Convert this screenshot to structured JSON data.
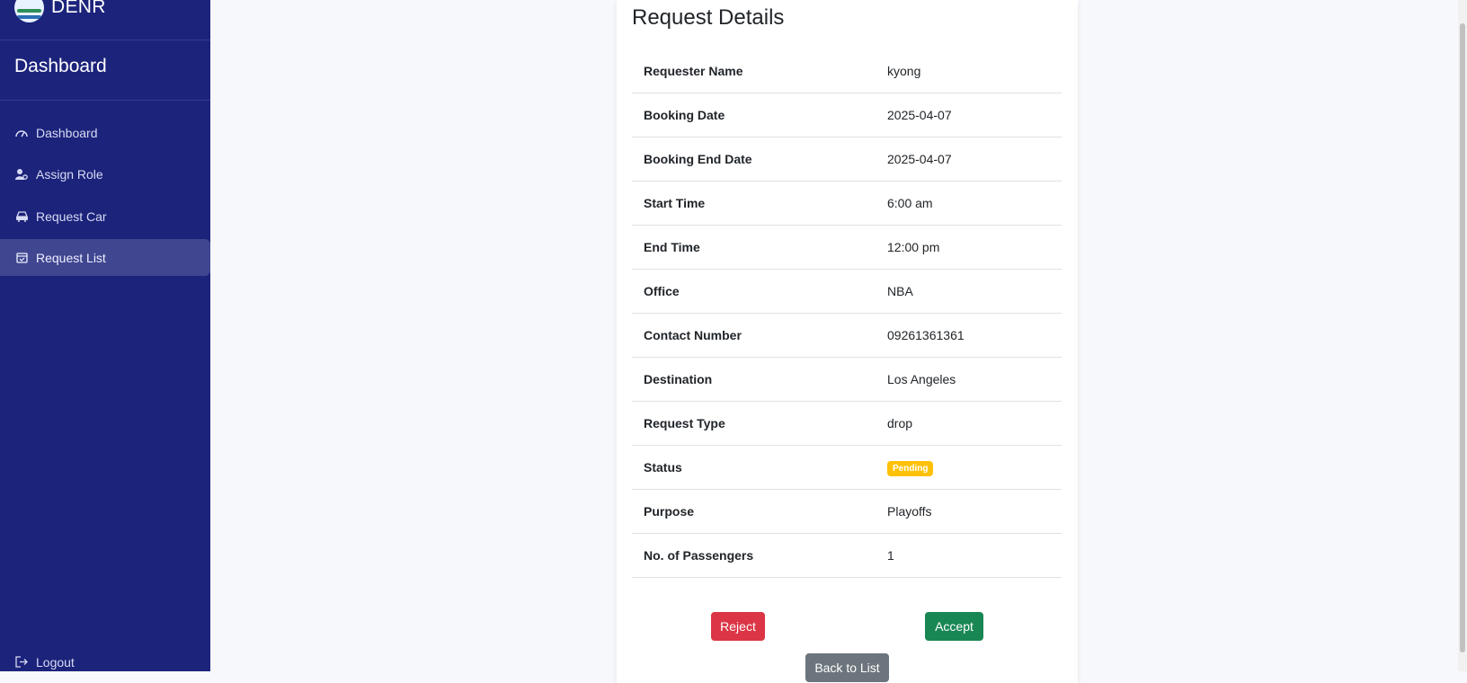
{
  "brand": {
    "name": "DENR"
  },
  "sidebar": {
    "title": "Dashboard",
    "items": [
      {
        "label": "Dashboard",
        "icon": "gauge-icon"
      },
      {
        "label": "Assign Role",
        "icon": "user-gear-icon"
      },
      {
        "label": "Request Car",
        "icon": "car-icon"
      },
      {
        "label": "Request List",
        "icon": "calendar-check-icon",
        "active": true
      }
    ],
    "logout": "Logout"
  },
  "details": {
    "title": "Request Details",
    "rows": [
      {
        "label": "Requester Name",
        "value": "kyong"
      },
      {
        "label": "Booking Date",
        "value": "2025-04-07"
      },
      {
        "label": "Booking End Date",
        "value": "2025-04-07"
      },
      {
        "label": "Start Time",
        "value": "6:00 am"
      },
      {
        "label": "End Time",
        "value": "12:00 pm"
      },
      {
        "label": "Office",
        "value": "NBA"
      },
      {
        "label": "Contact Number",
        "value": "09261361361"
      },
      {
        "label": "Destination",
        "value": "Los Angeles"
      },
      {
        "label": "Request Type",
        "value": "drop"
      },
      {
        "label": "Status",
        "value": "Pending"
      },
      {
        "label": "Purpose",
        "value": "Playoffs"
      },
      {
        "label": "No. of Passengers",
        "value": "1"
      }
    ]
  },
  "actions": {
    "reject": "Reject",
    "accept": "Accept",
    "back": "Back to List"
  },
  "colors": {
    "sidebar": "#1c237b",
    "reject": "#dc3545",
    "accept": "#198754",
    "back": "#6c757d",
    "pending": "#ffc107"
  }
}
